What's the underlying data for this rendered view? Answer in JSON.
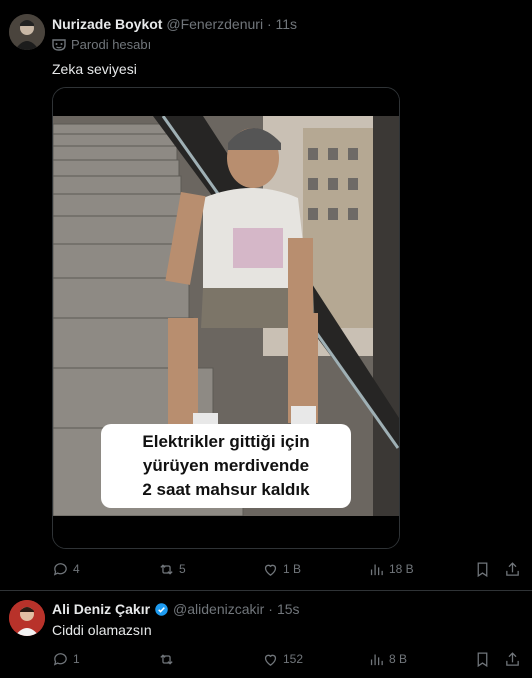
{
  "tweet1": {
    "name": "Nurizade Boykot",
    "handle": "@Fenerzdenuri",
    "separator": "·",
    "time": "11s",
    "parody_label": "Parodi hesabı",
    "text": "Zeka seviyesi",
    "media_caption": [
      "Elektrikler gittiği için",
      "yürüyen merdivende",
      "2 saat mahsur kaldık"
    ],
    "replies": "4",
    "retweets": "5",
    "likes": "1 B",
    "views": "18 B"
  },
  "tweet2": {
    "name": "Ali Deniz Çakır",
    "handle": "@alidenizcakir",
    "separator": "·",
    "time": "15s",
    "text": "Ciddi olamazsın",
    "replies": "1",
    "retweets": "",
    "likes": "152",
    "views": "8 B"
  },
  "colors": {
    "background": "#000000",
    "muted": "#71767b",
    "verified": "#1d9bf0",
    "divider": "#2f3336"
  }
}
